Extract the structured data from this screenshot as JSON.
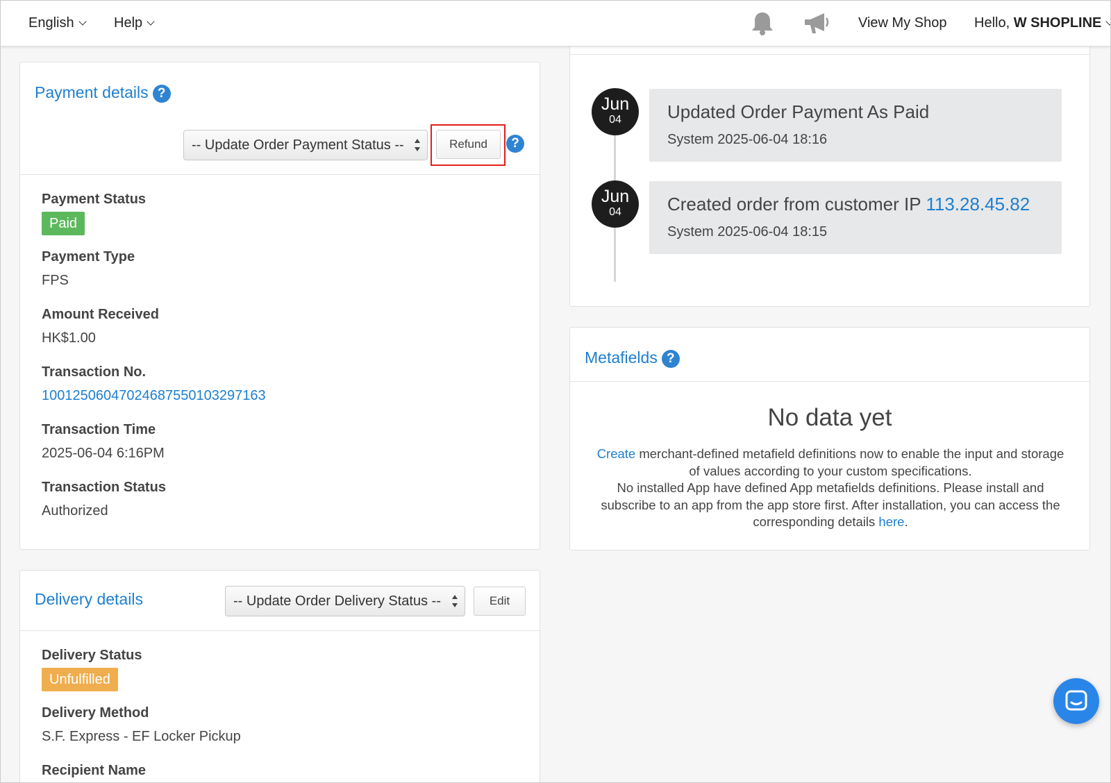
{
  "nav": {
    "language": "English",
    "help": "Help",
    "view_shop": "View My Shop",
    "hello_prefix": "Hello, ",
    "hello_name": "W SHOPLINE"
  },
  "payment": {
    "title": "Payment details",
    "status_select": "-- Update Order Payment Status --",
    "refund_label": "Refund",
    "fields": [
      {
        "label": "Payment Status",
        "value": "Paid"
      },
      {
        "label": "Payment Type",
        "value": "FPS"
      },
      {
        "label": "Amount Received",
        "value": "HK$1.00"
      },
      {
        "label": "Transaction No.",
        "value": "10012506047024687550103297163"
      },
      {
        "label": "Transaction Time",
        "value": "2025-06-04 6:16PM"
      },
      {
        "label": "Transaction Status",
        "value": "Authorized"
      }
    ],
    "paid_color": "#5cb85c"
  },
  "delivery": {
    "title": "Delivery details",
    "status_select": "-- Update Order Delivery Status --",
    "edit_label": "Edit",
    "fields": [
      {
        "label": "Delivery Status",
        "value": "Unfulfilled"
      },
      {
        "label": "Delivery Method",
        "value": "S.F. Express - EF Locker Pickup"
      },
      {
        "label": "Recipient Name",
        "value": ""
      }
    ],
    "unfulfilled_color": "#f0ad4e"
  },
  "timeline": [
    {
      "month": "Jun",
      "day": "04",
      "title": "Updated Order Payment As Paid",
      "title_link": "",
      "meta": "System 2025-06-04 18:16"
    },
    {
      "month": "Jun",
      "day": "04",
      "title": "Created order from customer IP ",
      "title_link": "113.28.45.82",
      "meta": "System 2025-06-04 18:15"
    }
  ],
  "metafields": {
    "title": "Metafields",
    "empty_title": "No data yet",
    "create_link": "Create",
    "text1": " merchant-defined metafield definitions now to enable the input and storage of values according to your custom specifications.",
    "text2": "No installed App have defined App metafields definitions. Please install and subscribe to an app from the app store first. After installation, you can access the corresponding details ",
    "here_link": "here",
    "text3": "."
  },
  "colors": {
    "link": "#1e7fd0",
    "help_icon": "#2f84d1",
    "highlight": "#e01e1e",
    "chat": "#2a85e8"
  },
  "icons": {
    "notifications": "bell-icon",
    "announcements": "megaphone-icon",
    "help": "question-circle-icon",
    "chat": "chat-icon"
  }
}
